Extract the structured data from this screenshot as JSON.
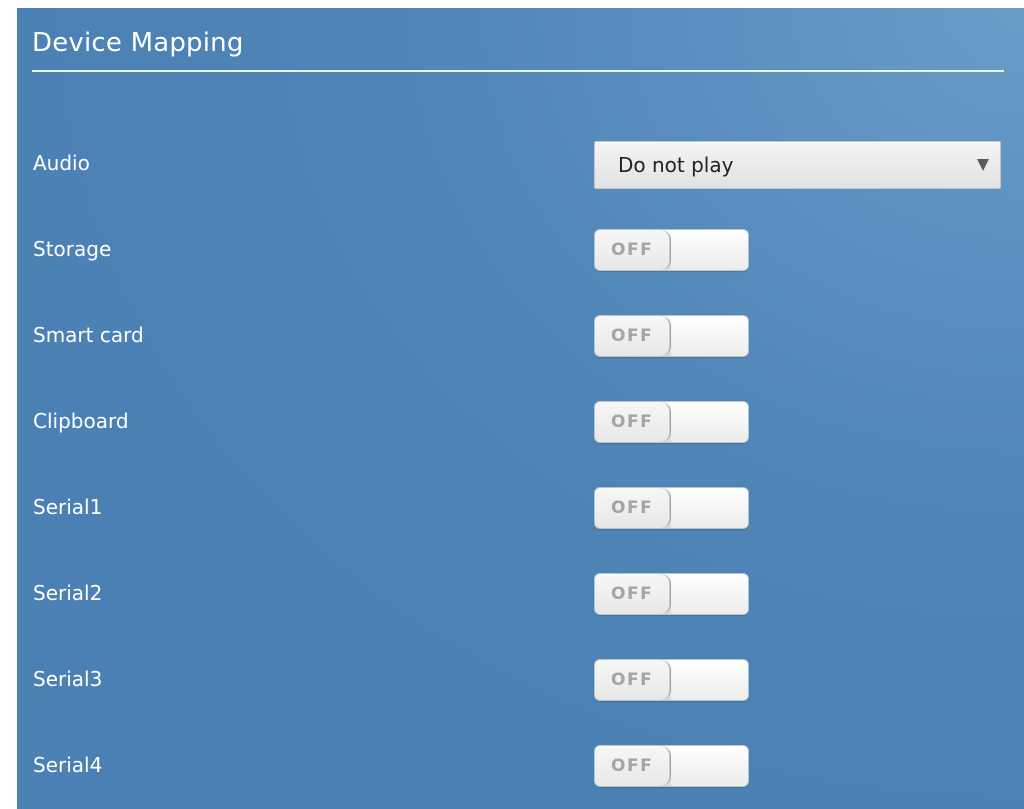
{
  "page": {
    "title": "Device Mapping"
  },
  "settings": {
    "audio": {
      "label": "Audio",
      "selected": "Do not play"
    },
    "toggles": [
      {
        "label": "Storage",
        "state": "OFF"
      },
      {
        "label": "Smart card",
        "state": "OFF"
      },
      {
        "label": "Clipboard",
        "state": "OFF"
      },
      {
        "label": "Serial1",
        "state": "OFF"
      },
      {
        "label": "Serial2",
        "state": "OFF"
      },
      {
        "label": "Serial3",
        "state": "OFF"
      },
      {
        "label": "Serial4",
        "state": "OFF"
      }
    ]
  },
  "icons": {
    "dropdown": "chevron-down-icon"
  },
  "colors": {
    "background": "#4e84b6",
    "title_rule": "#eaf2fa",
    "select_bg": "#e8e8e8",
    "toggle_text": "#a4a4a4"
  }
}
